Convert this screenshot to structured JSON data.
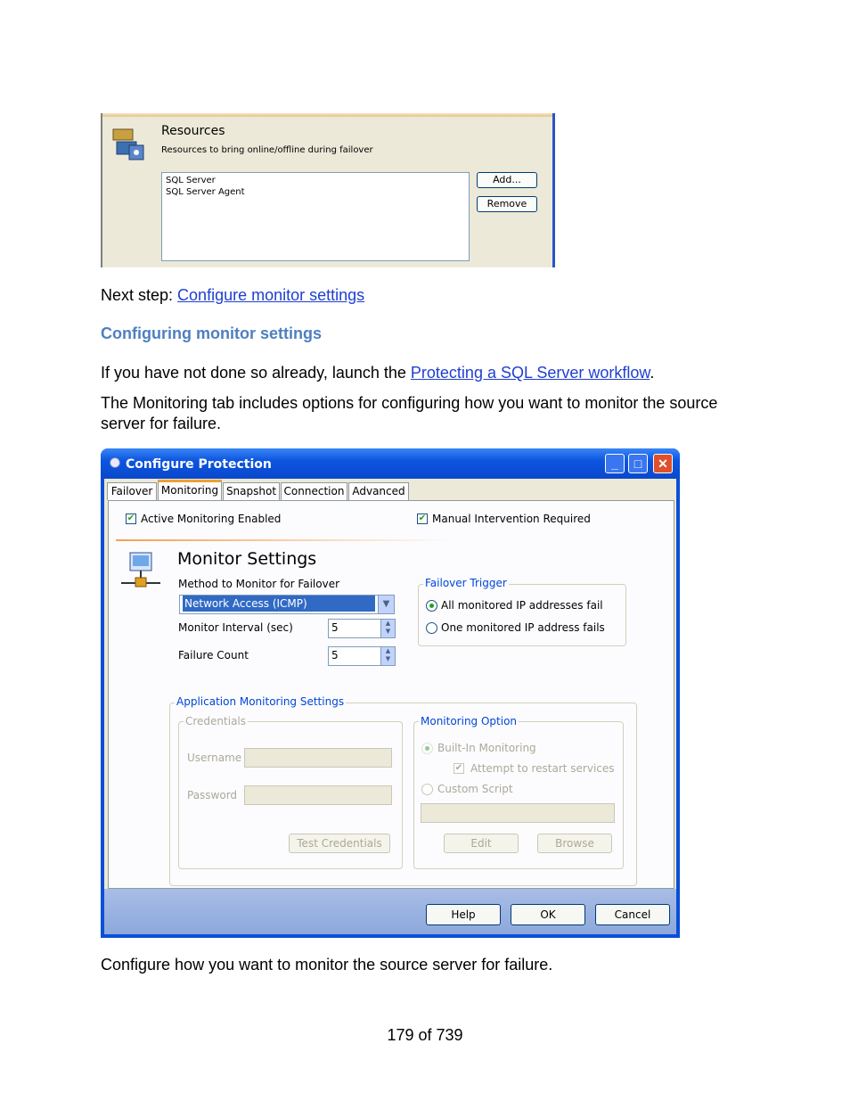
{
  "resources_shot": {
    "title": "Resources",
    "subtitle": "Resources to bring online/offline during failover",
    "items": [
      "SQL Server",
      "SQL Server Agent"
    ],
    "add_label": "Add...",
    "remove_label": "Remove"
  },
  "next_step": {
    "prefix": "Next step: ",
    "link": "Configure monitor settings"
  },
  "section_heading": "Configuring monitor settings",
  "para1": {
    "before": "If you have not done so already, launch the ",
    "link": "Protecting a SQL Server workflow",
    "after": "."
  },
  "para2": {
    "line1": "The Monitoring tab includes options for configuring how you want to monitor the source",
    "line2": "server for failure."
  },
  "window": {
    "title": "Configure Protection",
    "tabs": [
      "Failover",
      "Monitoring",
      "Snapshot",
      "Connection",
      "Advanced"
    ],
    "active_tab": "Monitoring",
    "active_monitoring_label": "Active Monitoring Enabled",
    "manual_intervention_label": "Manual Intervention Required",
    "section_title": "Monitor Settings",
    "method_label": "Method to Monitor for Failover",
    "method_value": "Network Access (ICMP)",
    "interval_label": "Monitor Interval (sec)",
    "interval_value": "5",
    "failure_label": "Failure Count",
    "failure_value": "5",
    "failover_trigger": {
      "title": "Failover Trigger",
      "opt1": "All monitored IP addresses fail",
      "opt2": "One monitored IP address fails"
    },
    "app_monitoring": {
      "title": "Application Monitoring Settings",
      "credentials": "Credentials",
      "username": "Username",
      "password": "Password",
      "test": "Test Credentials",
      "monitoring_option": "Monitoring Option",
      "builtin": "Built-In Monitoring",
      "restart": "Attempt to restart services",
      "custom": "Custom Script",
      "edit": "Edit",
      "browse": "Browse"
    },
    "help": "Help",
    "ok": "OK",
    "cancel": "Cancel"
  },
  "caption": "Configure how you want to monitor the source server for failure.",
  "page_number": "179 of 739",
  "colors": {
    "link": "#1f3fd0",
    "heading": "#4f7fbf",
    "xp_blue": "#0a4fd6"
  }
}
